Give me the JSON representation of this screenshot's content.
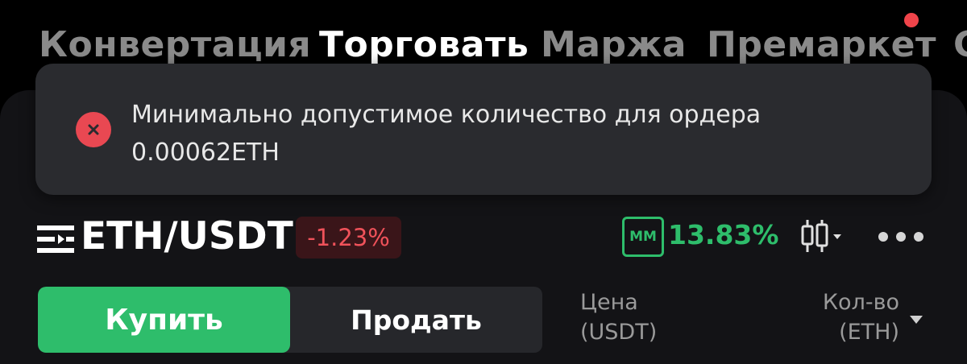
{
  "top_tabs": [
    {
      "label": "Конвертация",
      "active": false
    },
    {
      "label": "Торговать",
      "active": true
    },
    {
      "label": "Маржа",
      "active": false
    },
    {
      "label": "Премаркет",
      "active": false
    },
    {
      "label": "С",
      "active": false
    }
  ],
  "toast": {
    "icon": "error-x-icon",
    "message_line1": "Минимально допустимое количество для ордера",
    "message_line2": "0.00062ETH"
  },
  "pair": {
    "menu_icon": "pair-list-icon",
    "name": "ETH/USDT",
    "change": "-1.23%"
  },
  "mm": {
    "badge": "MM",
    "value": "13.83%"
  },
  "toolbar": {
    "chart_icon": "candlestick-chart-icon",
    "more_icon": "more-dots-icon"
  },
  "order": {
    "buy_label": "Купить",
    "sell_label": "Продать"
  },
  "orderbook_header": {
    "price_label": "Цена",
    "price_unit": "(USDT)",
    "qty_label": "Кол-во",
    "qty_unit": "(ETH)"
  },
  "colors": {
    "up": "#2ebd6b",
    "down": "#f0525a",
    "error": "#e94852",
    "notification": "#f0444a"
  }
}
